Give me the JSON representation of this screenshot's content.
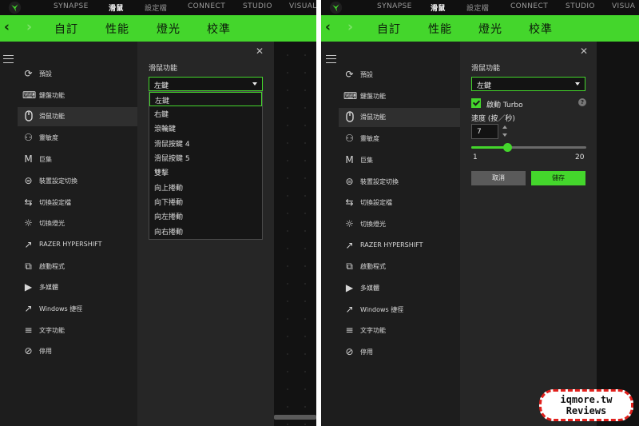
{
  "colors": {
    "accent": "#44d62c",
    "background": "#1d1d1d",
    "panel": "#262626",
    "canvas": "#121212"
  },
  "topnav": {
    "logo_icon": "razer-logo-icon",
    "left_items": [
      "SYNAPSE",
      "滑鼠",
      "設定檔",
      "CONNECT",
      "STUDIO",
      "VISUALI"
    ],
    "right_items": [
      "SYNAPSE",
      "滑鼠",
      "設定檔",
      "CONNECT",
      "STUDIO",
      "VISUA"
    ],
    "active": "滑鼠"
  },
  "tabs": {
    "back_icon": "chevron-left-icon",
    "forward_icon": "chevron-right-icon",
    "items": [
      "自訂",
      "性能",
      "燈光",
      "校準"
    ],
    "active": "自訂"
  },
  "sidebar": {
    "menu_icon": "hamburger-menu-icon",
    "items": [
      {
        "label": "預設",
        "icon": "reset-icon"
      },
      {
        "label": "鍵盤功能",
        "icon": "keyboard-icon"
      },
      {
        "label": "滑鼠功能",
        "icon": "mouse-icon"
      },
      {
        "label": "靈敏度",
        "icon": "sensitivity-icon"
      },
      {
        "label": "巨集",
        "icon": "macro-icon"
      },
      {
        "label": "裝置設定切換",
        "icon": "device-switch-icon"
      },
      {
        "label": "切換設定檔",
        "icon": "profile-switch-icon"
      },
      {
        "label": "切換燈光",
        "icon": "lighting-icon"
      },
      {
        "label": "RAZER HYPERSHIFT",
        "icon": "hypershift-icon"
      },
      {
        "label": "啟動程式",
        "icon": "launch-program-icon"
      },
      {
        "label": "多媒體",
        "icon": "multimedia-icon"
      },
      {
        "label": "Windows 捷徑",
        "icon": "windows-shortcut-icon"
      },
      {
        "label": "文字功能",
        "icon": "text-function-icon"
      },
      {
        "label": "停用",
        "icon": "disable-icon"
      }
    ],
    "active": "滑鼠功能"
  },
  "left_panel": {
    "title": "滑鼠功能",
    "select_value": "左鍵",
    "options": [
      "左鍵",
      "右鍵",
      "滾輪鍵",
      "滑鼠按鍵 4",
      "滑鼠按鍵 5",
      "雙擊",
      "向上捲動",
      "向下捲動",
      "向左捲動",
      "向右捲動"
    ],
    "highlighted": "左鍵"
  },
  "right_panel": {
    "title": "滑鼠功能",
    "select_value": "左鍵",
    "turbo_label": "啟動 Turbo",
    "turbo_checked": true,
    "help_icon": "question-icon",
    "speed_label": "速度 (按／秒)",
    "speed_value": "7",
    "slider": {
      "min": 1,
      "max": 20,
      "value": 7,
      "min_label": "1",
      "max_label": "20"
    },
    "cancel_label": "取消",
    "save_label": "儲存"
  },
  "watermark": {
    "line1": "iqmore.tw",
    "line2": "Reviews"
  }
}
